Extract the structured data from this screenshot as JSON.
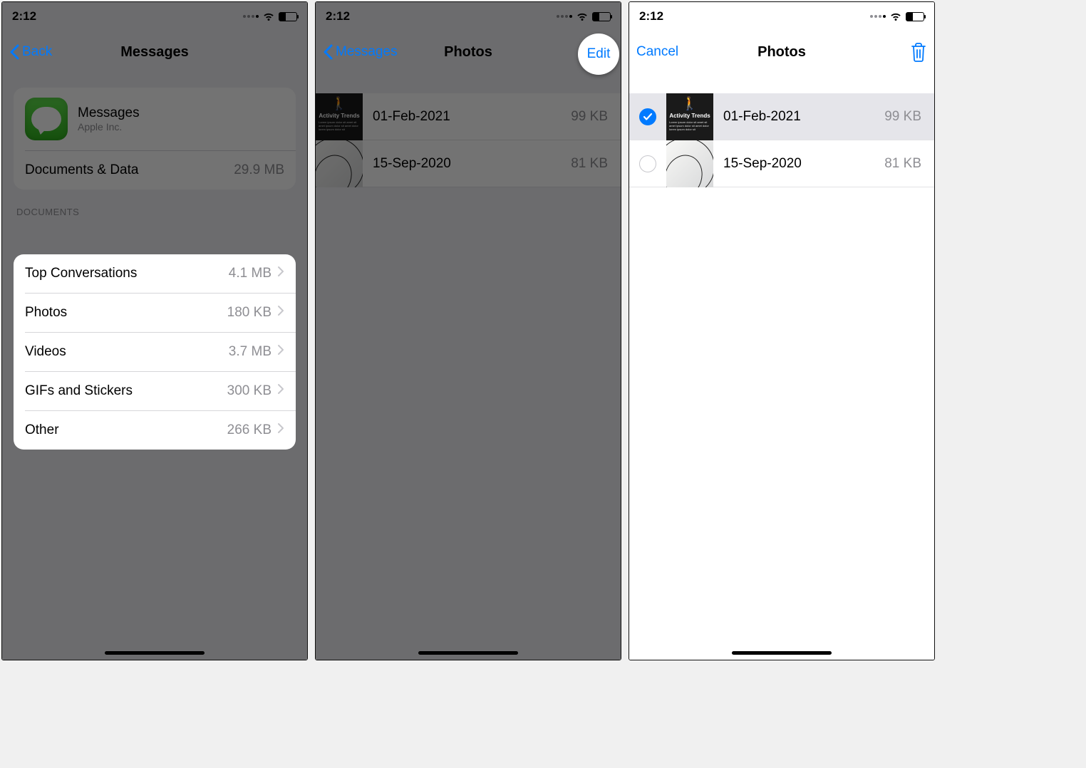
{
  "status": {
    "time": "2:12"
  },
  "screen1": {
    "back": "Back",
    "title": "Messages",
    "app": {
      "name": "Messages",
      "vendor": "Apple Inc."
    },
    "dataRow": {
      "label": "Documents & Data",
      "value": "29.9 MB"
    },
    "section": "DOCUMENTS",
    "items": [
      {
        "label": "Top Conversations",
        "value": "4.1 MB"
      },
      {
        "label": "Photos",
        "value": "180 KB"
      },
      {
        "label": "Videos",
        "value": "3.7 MB"
      },
      {
        "label": "GIFs and Stickers",
        "value": "300 KB"
      },
      {
        "label": "Other",
        "value": "266 KB"
      }
    ]
  },
  "screen2": {
    "back": "Messages",
    "title": "Photos",
    "edit": "Edit",
    "items": [
      {
        "label": "01-Feb-2021",
        "value": "99 KB",
        "thumb_caption": "Activity Trends"
      },
      {
        "label": "15-Sep-2020",
        "value": "81 KB"
      }
    ]
  },
  "screen3": {
    "cancel": "Cancel",
    "title": "Photos",
    "items": [
      {
        "label": "01-Feb-2021",
        "value": "99 KB",
        "selected": true,
        "thumb_caption": "Activity Trends"
      },
      {
        "label": "15-Sep-2020",
        "value": "81 KB",
        "selected": false
      }
    ]
  }
}
